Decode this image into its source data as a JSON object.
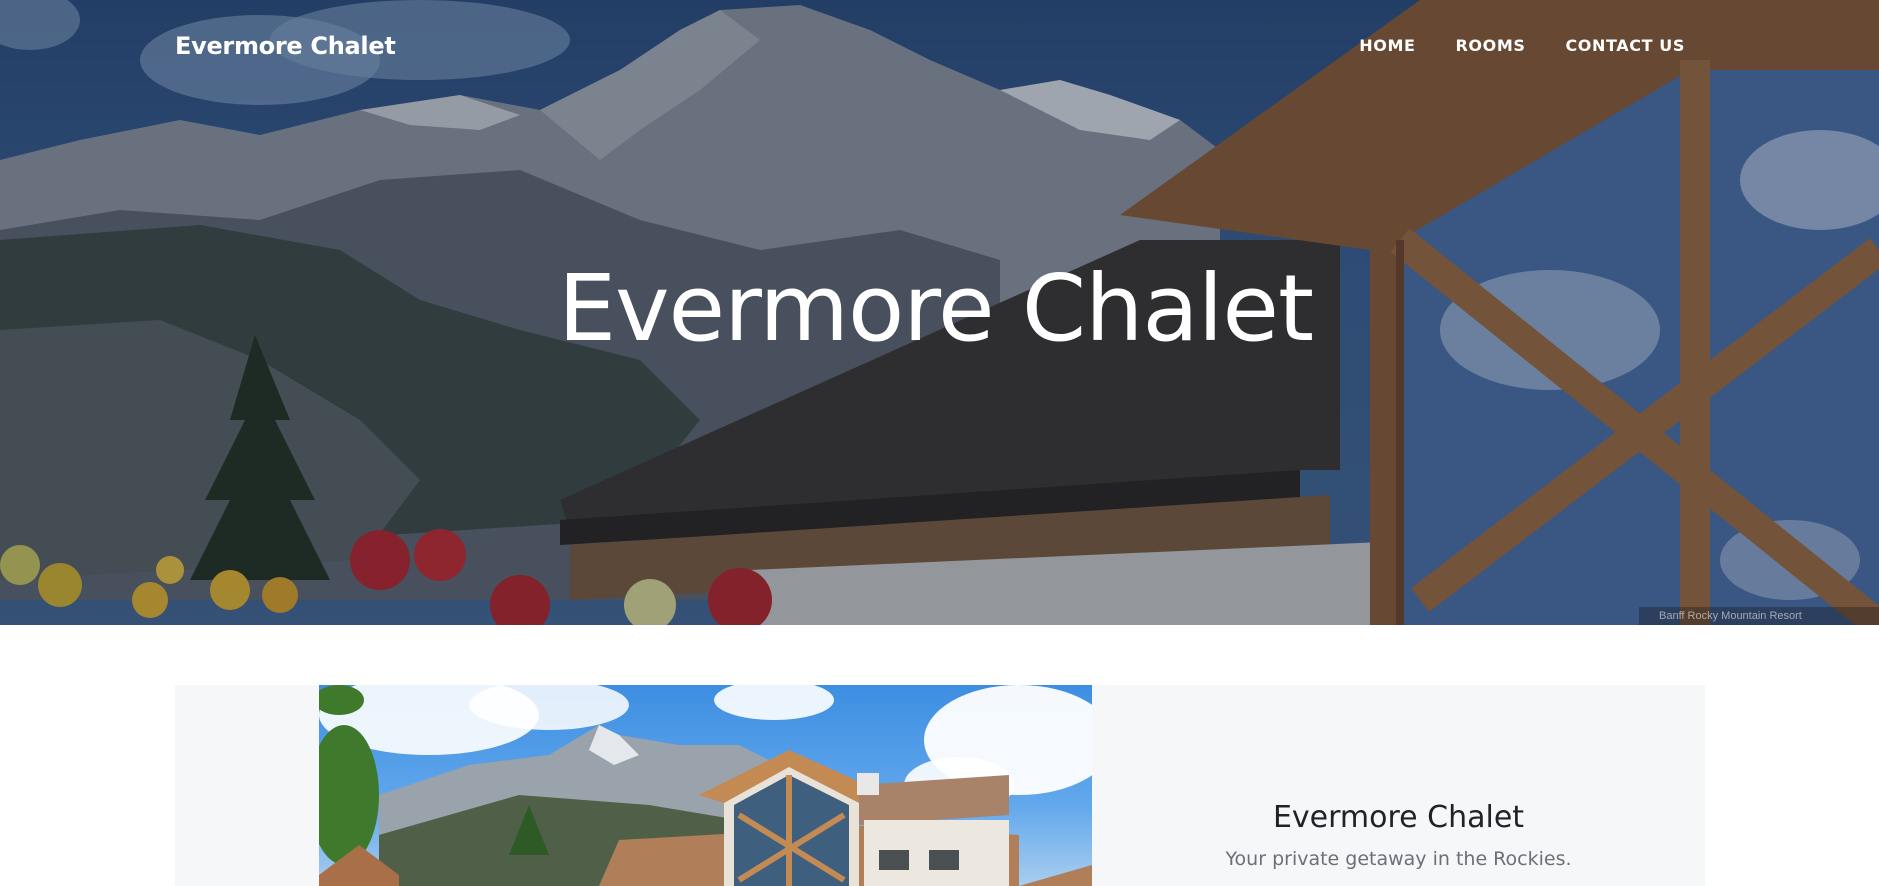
{
  "navbar": {
    "brand": "Evermore Chalet",
    "links": [
      {
        "label": "HOME"
      },
      {
        "label": "ROOMS"
      },
      {
        "label": "CONTACT US"
      }
    ]
  },
  "hero": {
    "title": "Evermore Chalet",
    "image": "mountain-chalet-photo",
    "credit": "Banff Rocky Mountain Resort"
  },
  "feature": {
    "image": "chalet-exterior-photo",
    "title": "Evermore Chalet",
    "subtitle": "Your private getaway in the Rockies."
  },
  "colors": {
    "overlay": "#0f1932",
    "panel_bg": "#f6f7f9",
    "title_text": "#1f2328",
    "subtitle_text": "#6b7078"
  }
}
